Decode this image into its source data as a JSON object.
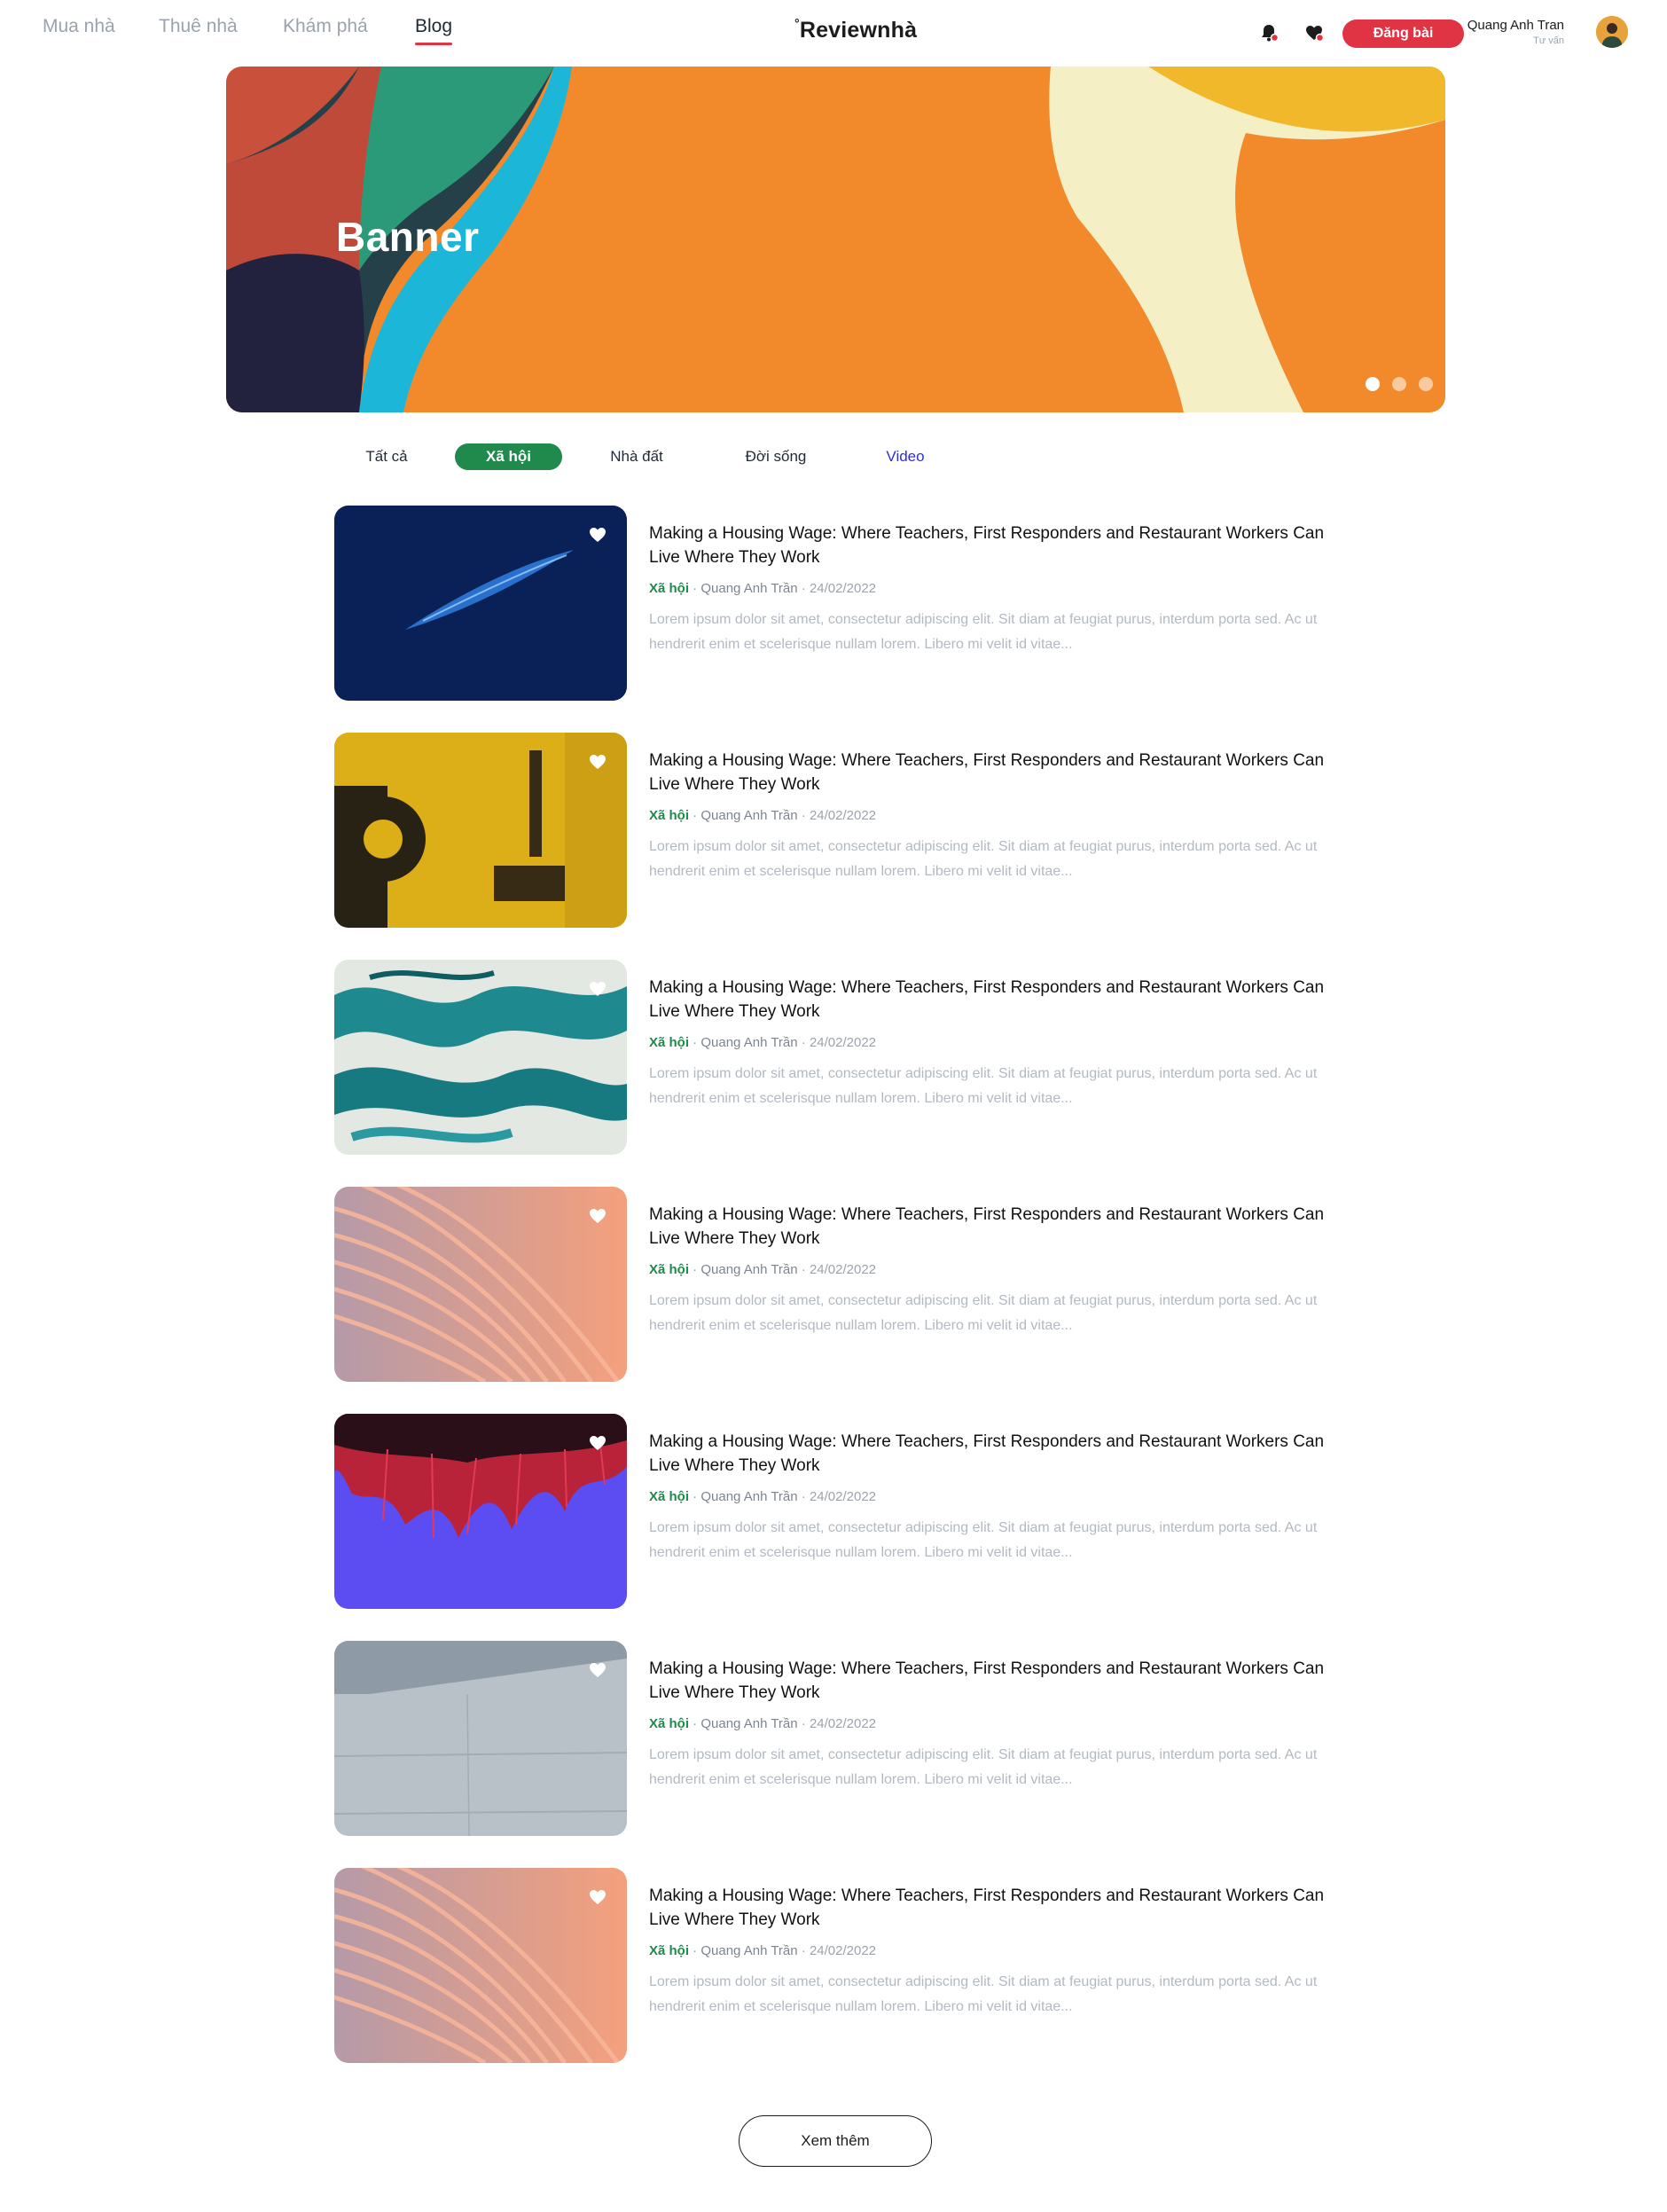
{
  "header": {
    "nav": [
      {
        "label": "Mua nhà",
        "active": false
      },
      {
        "label": "Thuê nhà",
        "active": false
      },
      {
        "label": "Khám phá",
        "active": false
      },
      {
        "label": "Blog",
        "active": true
      }
    ],
    "logo_prefix": "°",
    "logo_text": "Reviewnhà",
    "icons": [
      "bell-icon",
      "heart-icon"
    ],
    "post_button": "Đăng bài",
    "user": {
      "name": "Quang Anh Tran",
      "role": "Tư vấn"
    }
  },
  "banner": {
    "title": "Banner",
    "slides_total": 3,
    "active_slide": 0
  },
  "tabs": [
    {
      "label": "Tất cả",
      "active": false
    },
    {
      "label": "Xã hội",
      "active": true
    },
    {
      "label": "Nhà đất",
      "active": false
    },
    {
      "label": "Đời sống",
      "active": false
    },
    {
      "label": "Video",
      "active": false
    }
  ],
  "articles": [
    {
      "title": "Making a Housing Wage: Where Teachers, First Responders and Restaurant Workers Can Live Where They Work",
      "category": "Xã hội",
      "author": "Quang Anh Trần",
      "date": "24/02/2022",
      "excerpt": "Lorem ipsum dolor sit amet, consectetur adipiscing elit. Sit diam at feugiat purus, interdum porta sed. Ac ut hendrerit enim et scelerisque nullam lorem. Libero mi velit id vitae..."
    },
    {
      "title": "Making a Housing Wage: Where Teachers, First Responders and Restaurant Workers Can Live Where They Work",
      "category": "Xã hội",
      "author": "Quang Anh Trần",
      "date": "24/02/2022",
      "excerpt": "Lorem ipsum dolor sit amet, consectetur adipiscing elit. Sit diam at feugiat purus, interdum porta sed. Ac ut hendrerit enim et scelerisque nullam lorem. Libero mi velit id vitae..."
    },
    {
      "title": "Making a Housing Wage: Where Teachers, First Responders and Restaurant Workers Can Live Where They Work",
      "category": "Xã hội",
      "author": "Quang Anh Trần",
      "date": "24/02/2022",
      "excerpt": "Lorem ipsum dolor sit amet, consectetur adipiscing elit. Sit diam at feugiat purus, interdum porta sed. Ac ut hendrerit enim et scelerisque nullam lorem. Libero mi velit id vitae..."
    },
    {
      "title": "Making a Housing Wage: Where Teachers, First Responders and Restaurant Workers Can Live Where They Work",
      "category": "Xã hội",
      "author": "Quang Anh Trần",
      "date": "24/02/2022",
      "excerpt": "Lorem ipsum dolor sit amet, consectetur adipiscing elit. Sit diam at feugiat purus, interdum porta sed. Ac ut hendrerit enim et scelerisque nullam lorem. Libero mi velit id vitae..."
    },
    {
      "title": "Making a Housing Wage: Where Teachers, First Responders and Restaurant Workers Can Live Where They Work",
      "category": "Xã hội",
      "author": "Quang Anh Trần",
      "date": "24/02/2022",
      "excerpt": "Lorem ipsum dolor sit amet, consectetur adipiscing elit. Sit diam at feugiat purus, interdum porta sed. Ac ut hendrerit enim et scelerisque nullam lorem. Libero mi velit id vitae..."
    },
    {
      "title": "Making a Housing Wage: Where Teachers, First Responders and Restaurant Workers Can Live Where They Work",
      "category": "Xã hội",
      "author": "Quang Anh Trần",
      "date": "24/02/2022",
      "excerpt": "Lorem ipsum dolor sit amet, consectetur adipiscing elit. Sit diam at feugiat purus, interdum porta sed. Ac ut hendrerit enim et scelerisque nullam lorem. Libero mi velit id vitae..."
    },
    {
      "title": "Making a Housing Wage: Where Teachers, First Responders and Restaurant Workers Can Live Where They Work",
      "category": "Xã hội",
      "author": "Quang Anh Trần",
      "date": "24/02/2022",
      "excerpt": "Lorem ipsum dolor sit amet, consectetur adipiscing elit. Sit diam at feugiat purus, interdum porta sed. Ac ut hendrerit enim et scelerisque nullam lorem. Libero mi velit id vitae..."
    }
  ],
  "load_more": "Xem thêm",
  "colors": {
    "accent_red": "#e03445",
    "category_green": "#1f8a4c",
    "video_blue": "#2e2fd6",
    "muted_text": "#9aa3ad"
  }
}
